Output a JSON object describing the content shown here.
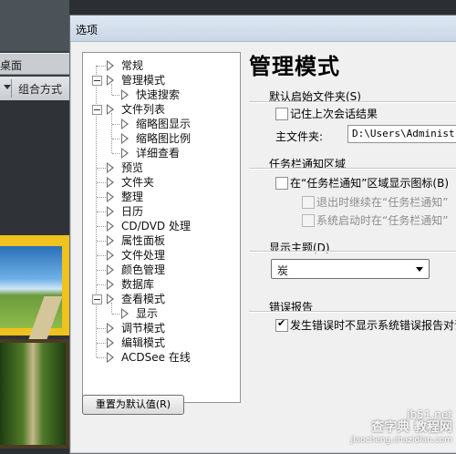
{
  "background_app": {
    "tab_label": "桌面",
    "toolbar_label": "组合方式"
  },
  "dialog": {
    "title": "选项",
    "reset_button": "重置为默认值(R)"
  },
  "tree": {
    "items": [
      {
        "label": "常规"
      },
      {
        "label": "管理模式"
      },
      {
        "label": "快速搜索"
      },
      {
        "label": "文件列表"
      },
      {
        "label": "缩略图显示"
      },
      {
        "label": "缩略图比例"
      },
      {
        "label": "详细查看"
      },
      {
        "label": "预览"
      },
      {
        "label": "文件夹"
      },
      {
        "label": "整理"
      },
      {
        "label": "日历"
      },
      {
        "label": "CD/DVD 处理"
      },
      {
        "label": "属性面板"
      },
      {
        "label": "文件处理"
      },
      {
        "label": "颜色管理"
      },
      {
        "label": "数据库"
      },
      {
        "label": "查看模式"
      },
      {
        "label": "显示"
      },
      {
        "label": "调节模式"
      },
      {
        "label": "编辑模式"
      },
      {
        "label": "ACDSee 在线"
      }
    ]
  },
  "panel": {
    "heading": "管理模式",
    "startup_folder": {
      "title": "默认启始文件夹(S)",
      "remember_label": "记住上次会话结果",
      "remember_checked": false,
      "main_folder_label": "主文件夹:",
      "main_folder_value": "D:\\Users\\Administrator\\"
    },
    "taskbar": {
      "title": "任务栏通知区域",
      "show_icon_label": "在“任务栏通知”区域显示图标(B)",
      "show_icon_checked": false,
      "continue_label": "退出时继续在“任务栏通知”",
      "startup_label": "系统启动时在“任务栏通知”"
    },
    "theme": {
      "title": "显示主题(D)",
      "selected": "炭"
    },
    "error_report": {
      "title": "错误报告",
      "label": "发生错误时不显示系统错误报告对话",
      "checked": true
    }
  },
  "watermark": {
    "line1": "jb51.net",
    "line2": "查字典 教程网",
    "line3": "jiaocheng.chazidian.com"
  }
}
